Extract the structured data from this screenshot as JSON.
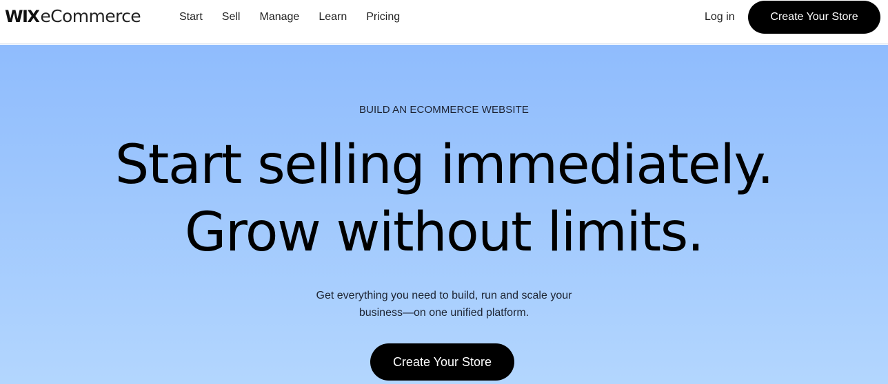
{
  "header": {
    "logo": {
      "brand": "WIX",
      "product": "eCommerce"
    },
    "nav": [
      {
        "label": "Start"
      },
      {
        "label": "Sell"
      },
      {
        "label": "Manage"
      },
      {
        "label": "Learn"
      },
      {
        "label": "Pricing"
      }
    ],
    "login_label": "Log in",
    "cta_label": "Create Your Store"
  },
  "hero": {
    "eyebrow": "BUILD AN ECOMMERCE WEBSITE",
    "headline_line1": "Start selling immediately.",
    "headline_line2": "Grow without limits.",
    "subtext_line1": "Get everything you need to build, run and scale your",
    "subtext_line2": "business—on one unified platform.",
    "cta_label": "Create Your Store"
  },
  "colors": {
    "hero_gradient_top": "#8fbcfd",
    "hero_gradient_bottom": "#b3d6fe",
    "button_bg": "#000000",
    "button_text": "#ffffff"
  }
}
